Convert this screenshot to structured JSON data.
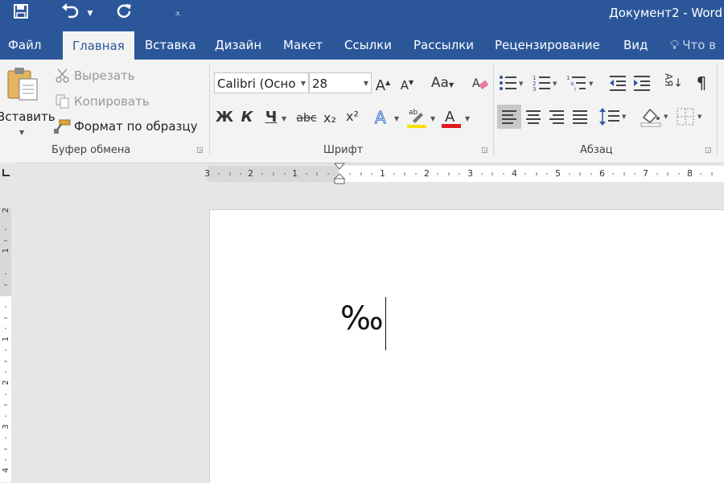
{
  "window": {
    "title": "Документ2 - Word"
  },
  "tabs": [
    {
      "label": "Файл"
    },
    {
      "label": "Главная"
    },
    {
      "label": "Вставка"
    },
    {
      "label": "Дизайн"
    },
    {
      "label": "Макет"
    },
    {
      "label": "Ссылки"
    },
    {
      "label": "Рассылки"
    },
    {
      "label": "Рецензирование"
    },
    {
      "label": "Вид"
    },
    {
      "label": "Что в"
    }
  ],
  "clipboard": {
    "paste_label": "Вставить",
    "cut_label": "Вырезать",
    "copy_label": "Копировать",
    "format_painter_label": "Формат по образцу",
    "group_label": "Буфер обмена"
  },
  "font": {
    "font_name": "Calibri (Осно",
    "font_size": "28",
    "grow_label": "A",
    "shrink_label": "A",
    "case_label": "Aa",
    "bold_label": "Ж",
    "italic_label": "К",
    "underline_label": "Ч",
    "strike_label": "abc",
    "subscript_label": "x₂",
    "superscript_label": "x²",
    "group_label": "Шрифт",
    "highlight_color": "#f5e100",
    "font_color": "#e0191f"
  },
  "paragraph": {
    "group_label": "Абзац",
    "sort_label": "АЯ"
  },
  "ruler": {
    "h_left_numbers": [
      "3",
      "2",
      "1"
    ],
    "h_right_numbers": [
      "1",
      "2",
      "3",
      "4",
      "5",
      "6",
      "7",
      "8"
    ],
    "v_numbers": [
      "2",
      "1",
      "1",
      "2",
      "3",
      "4"
    ]
  },
  "document": {
    "text": "‰"
  }
}
